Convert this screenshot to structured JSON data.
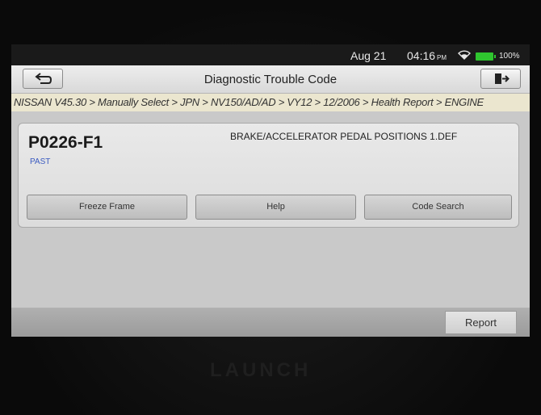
{
  "status_bar": {
    "date": "Aug 21",
    "time": "04:16",
    "ampm": "PM",
    "battery": "100%",
    "wifi_icon": "wifi-icon",
    "battery_icon": "battery-icon"
  },
  "title_bar": {
    "title": "Diagnostic Trouble Code",
    "back_icon": "back-arrow-icon",
    "exit_icon": "exit-icon"
  },
  "breadcrumb": "NISSAN V45.30 > Manually Select > JPN > NV150/AD/AD > VY12 > 12/2006 > Health Report > ENGINE",
  "dtc": {
    "code": "P0226-F1",
    "status": "PAST",
    "description": "BRAKE/ACCELERATOR PEDAL POSITIONS 1.DEF",
    "status_color": "#3a5ac0"
  },
  "actions": {
    "freeze_frame": "Freeze Frame",
    "help": "Help",
    "code_search": "Code Search"
  },
  "footer": {
    "report": "Report"
  },
  "device": {
    "brand": "LAUNCH"
  },
  "colors": {
    "breadcrumb_bg": "#ebe6cf",
    "battery": "#2fc52f"
  }
}
